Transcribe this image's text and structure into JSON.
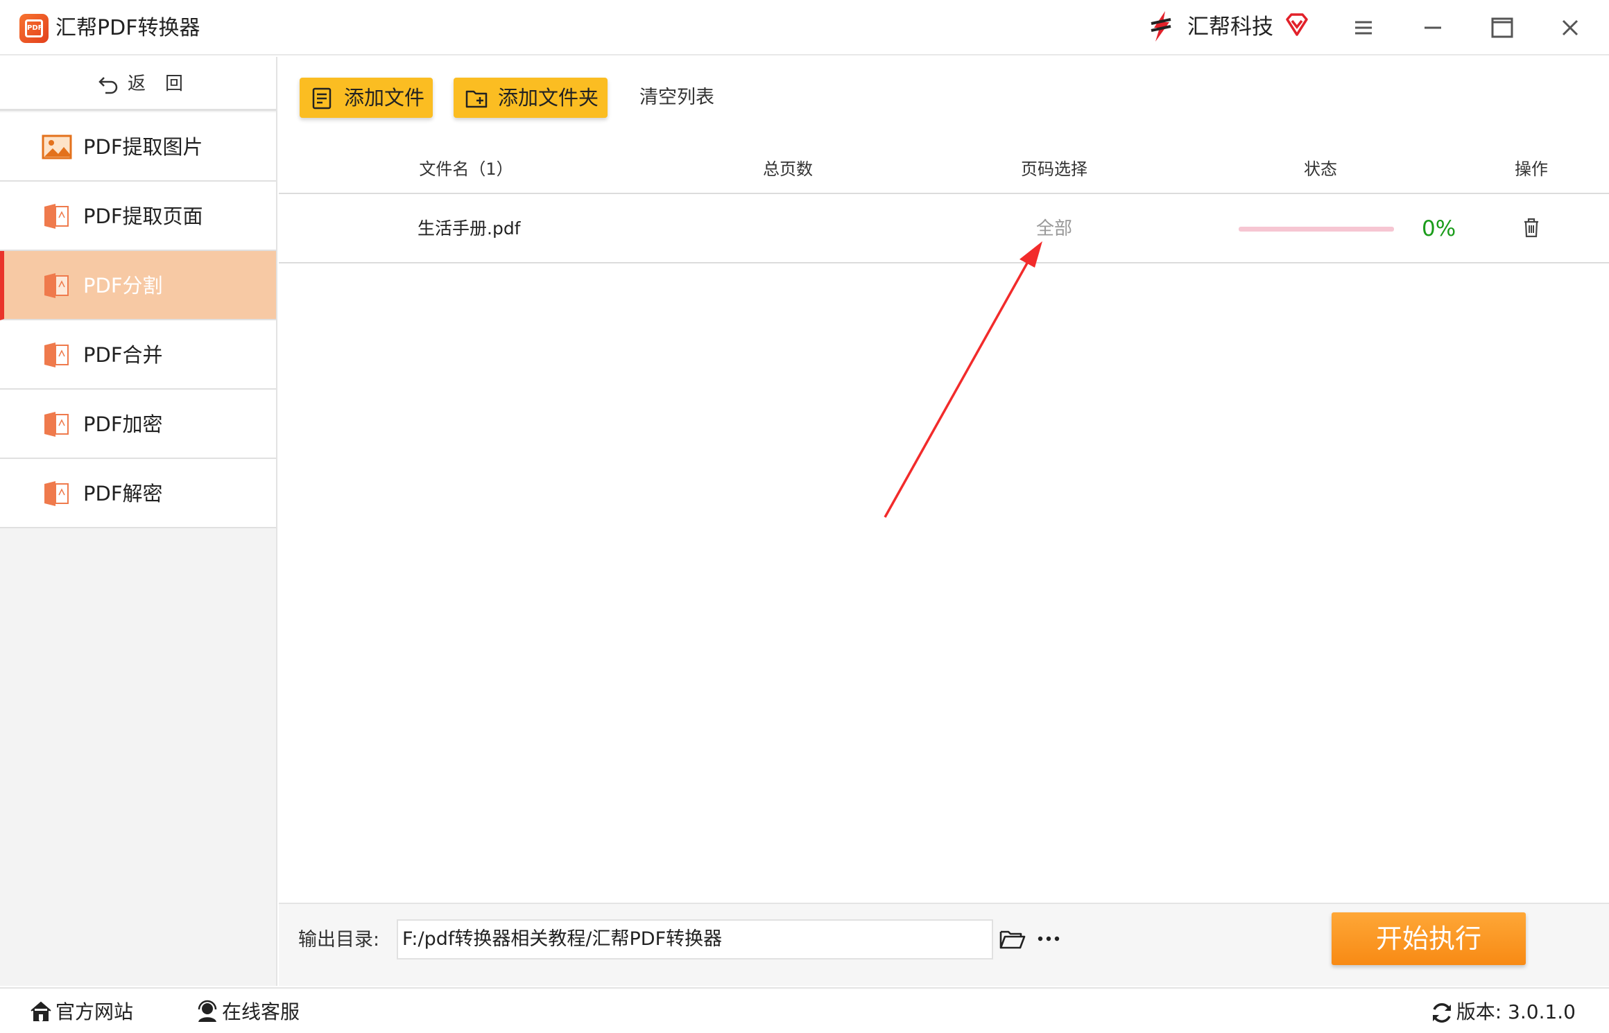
{
  "window": {
    "title": "汇帮PDF转换器",
    "brand": "汇帮科技",
    "accent": "#fbbd22",
    "active_color": "#f7c9a4"
  },
  "sidebar": {
    "back_label": "返回",
    "items": [
      {
        "label": "PDF提取图片",
        "icon": "image-icon"
      },
      {
        "label": "PDF提取页面",
        "icon": "pdf-file-icon"
      },
      {
        "label": "PDF分割",
        "icon": "pdf-file-icon",
        "active": true
      },
      {
        "label": "PDF合并",
        "icon": "pdf-file-icon"
      },
      {
        "label": "PDF加密",
        "icon": "pdf-file-icon"
      },
      {
        "label": "PDF解密",
        "icon": "pdf-file-icon"
      }
    ]
  },
  "toolbar": {
    "add_file": "添加文件",
    "add_folder": "添加文件夹",
    "clear_list": "清空列表"
  },
  "table": {
    "columns": {
      "filename": "文件名（1）",
      "total_pages": "总页数",
      "page_select": "页码选择",
      "status": "状态",
      "action": "操作"
    },
    "rows": [
      {
        "filename": "生活手册.pdf",
        "total_pages": "",
        "page_select": "全部",
        "progress_percent": 0,
        "progress_label": "0%"
      }
    ]
  },
  "output": {
    "label": "输出目录:",
    "path": "F:/pdf转换器相关教程/汇帮PDF转换器",
    "start_button": "开始执行"
  },
  "statusbar": {
    "website": "官方网站",
    "support": "在线客服",
    "version": "版本: 3.0.1.0"
  }
}
